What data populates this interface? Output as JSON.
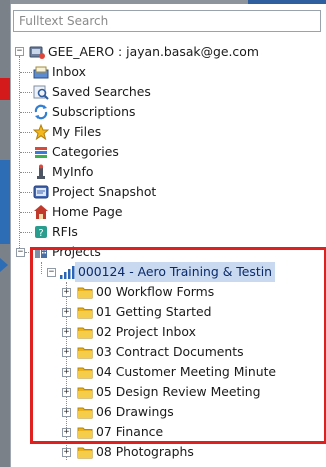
{
  "search": {
    "placeholder": "Fulltext Search"
  },
  "root": {
    "label": "GEE_AERO : jayan.basak@ge.com"
  },
  "items": [
    {
      "label": "Inbox",
      "icon": "inbox-icon"
    },
    {
      "label": "Saved Searches",
      "icon": "saved-search-icon"
    },
    {
      "label": "Subscriptions",
      "icon": "subscriptions-icon"
    },
    {
      "label": "My Files",
      "icon": "star-icon"
    },
    {
      "label": "Categories",
      "icon": "categories-icon"
    },
    {
      "label": "MyInfo",
      "icon": "info-icon"
    },
    {
      "label": "Project Snapshot",
      "icon": "snapshot-icon"
    },
    {
      "label": "Home Page",
      "icon": "home-icon"
    },
    {
      "label": "RFIs",
      "icon": "rfi-icon"
    }
  ],
  "projects": {
    "label": "Projects",
    "project": {
      "label": "000124 - Aero Training & Testin",
      "folders": [
        "00 Workflow Forms",
        "01 Getting Started",
        "02 Project Inbox",
        "03 Contract Documents",
        "04 Customer Meeting Minute",
        "05 Design Review Meeting",
        "06 Drawings",
        "07 Finance",
        "08 Photographs"
      ]
    }
  },
  "colors": {
    "highlight": "#e01f1f",
    "folder": "#f4c430",
    "accent": "#2d6db5"
  }
}
